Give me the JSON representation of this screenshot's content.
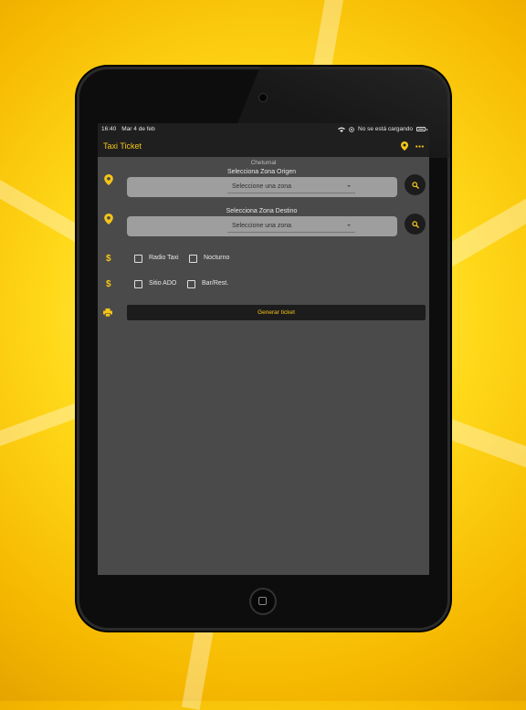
{
  "status_bar": {
    "time": "16:40",
    "date": "Mar 4 de feb",
    "charging": "No se está cargando"
  },
  "app_bar": {
    "title": "Taxi Ticket"
  },
  "city": "Chetumal",
  "origin": {
    "label": "Selecciona Zona Origen",
    "placeholder": "Seleccione una zona"
  },
  "destination": {
    "label": "Selecciona Zona Destino",
    "placeholder": "Seleccione una zona"
  },
  "options": {
    "row1": [
      "Radio Taxi",
      "Nocturno"
    ],
    "row2": [
      "Sitio ADO",
      "Bar/Rest."
    ]
  },
  "generate_label": "Generar ticket",
  "colors": {
    "accent": "#f5c518",
    "screen_bg": "#4a4a4a",
    "bar_bg": "#1f1f1f"
  }
}
